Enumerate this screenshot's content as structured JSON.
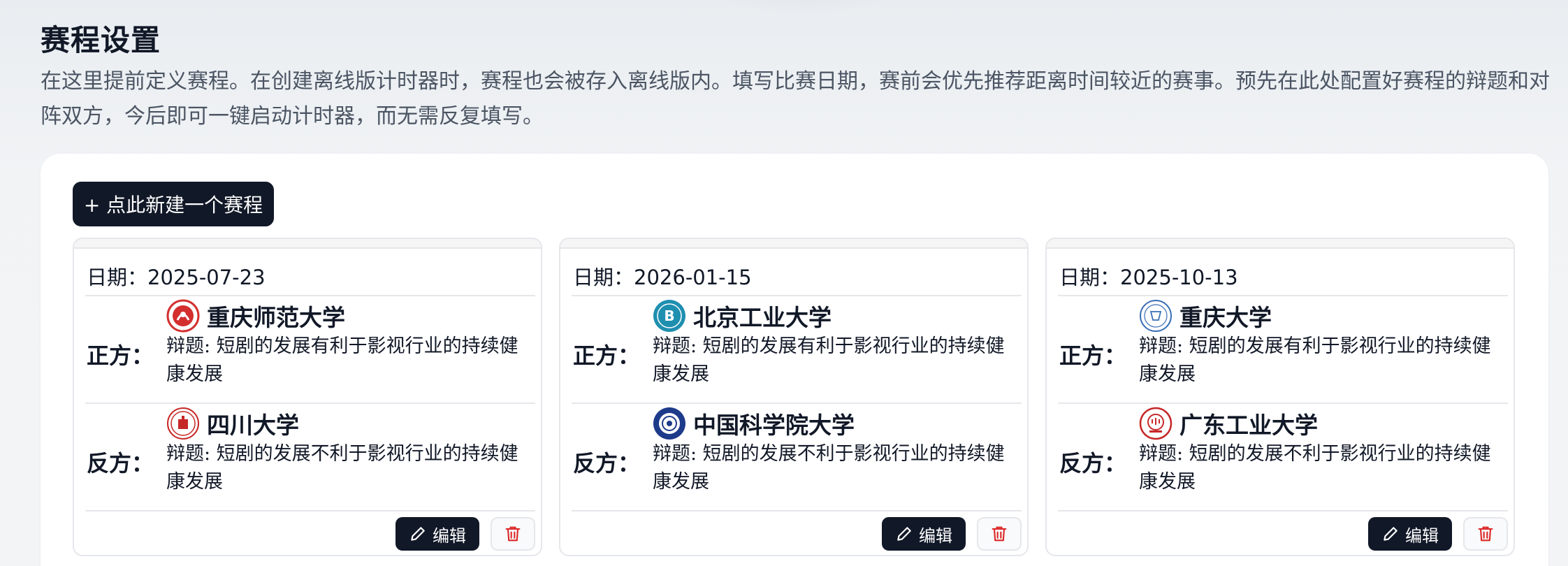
{
  "page": {
    "title": "赛程设置",
    "description": "在这里提前定义赛程。在创建离线版计时器时，赛程也会被存入离线版内。填写比赛日期，赛前会优先推荐距离时间较近的赛事。预先在此处配置好赛程的辩题和对阵双方，今后即可一键启动计时器，而无需反复填写。"
  },
  "toolbar": {
    "new_button_label": "+ 点此新建一个赛程"
  },
  "labels": {
    "date_prefix": "日期：",
    "affirmative": "正方：",
    "negative": "反方：",
    "edit": "编辑"
  },
  "colors": {
    "primary_dark": "#111827",
    "delete_red": "#dc2626"
  },
  "matches": [
    {
      "date": "2025-07-23",
      "affirmative": {
        "school": "重庆师范大学",
        "logo_icon": "cqnu-logo-icon",
        "logo_color": "#d32f2f",
        "motion": "辩题: 短剧的发展有利于影视行业的持续健康发展"
      },
      "negative": {
        "school": "四川大学",
        "logo_icon": "scu-logo-icon",
        "logo_color": "#c62828",
        "motion": "辩题: 短剧的发展不利于影视行业的持续健康发展"
      }
    },
    {
      "date": "2026-01-15",
      "affirmative": {
        "school": "北京工业大学",
        "logo_icon": "bjut-logo-icon",
        "logo_color": "#1f8fb0",
        "motion": "辩题: 短剧的发展有利于影视行业的持续健康发展"
      },
      "negative": {
        "school": "中国科学院大学",
        "logo_icon": "ucas-logo-icon",
        "logo_color": "#1e3a8a",
        "motion": "辩题: 短剧的发展不利于影视行业的持续健康发展"
      }
    },
    {
      "date": "2025-10-13",
      "affirmative": {
        "school": "重庆大学",
        "logo_icon": "cqu-logo-icon",
        "logo_color": "#3b6fb6",
        "motion": "辩题: 短剧的发展有利于影视行业的持续健康发展"
      },
      "negative": {
        "school": "广东工业大学",
        "logo_icon": "gdut-logo-icon",
        "logo_color": "#c62828",
        "motion": "辩题: 短剧的发展不利于影视行业的持续健康发展"
      }
    }
  ]
}
